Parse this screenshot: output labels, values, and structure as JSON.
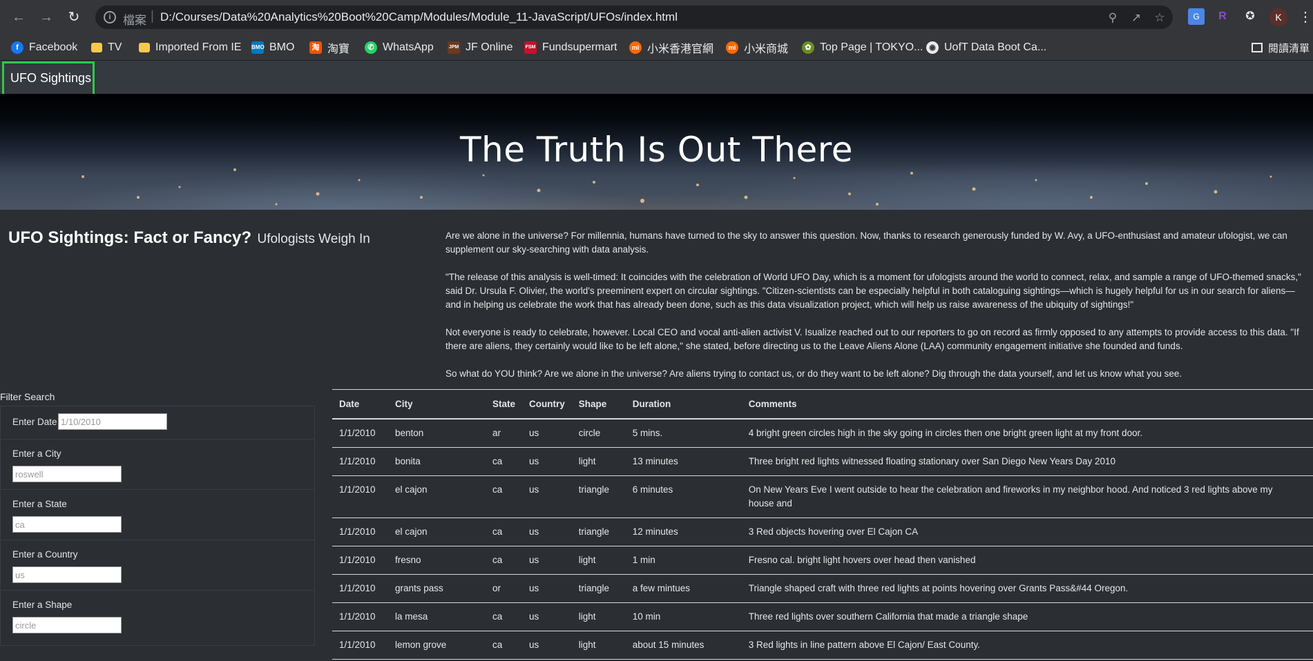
{
  "browser": {
    "url_scheme": "檔案",
    "url": "D:/Courses/Data%20Analytics%20Boot%20Camp/Modules/Module_11-JavaScript/UFOs/index.html",
    "profile_initial": "K",
    "bookmarks": [
      {
        "label": "Facebook",
        "icon": "facebook-icon",
        "color": "#1877f2"
      },
      {
        "label": "TV",
        "icon": "folder-icon",
        "color": "#f6c94a"
      },
      {
        "label": "Imported From IE",
        "icon": "folder-icon",
        "color": "#f6c94a"
      },
      {
        "label": "BMO",
        "icon": "bmo-icon",
        "color": "#0079c1"
      },
      {
        "label": "淘寶",
        "icon": "taobao-icon",
        "color": "#ff5000"
      },
      {
        "label": "WhatsApp",
        "icon": "whatsapp-icon",
        "color": "#25d366"
      },
      {
        "label": "JF Online",
        "icon": "jpm-icon",
        "color": "#6b3a1f"
      },
      {
        "label": "Fundsupermart",
        "icon": "fsm-icon",
        "color": "#c8102e"
      },
      {
        "label": "小米香港官網",
        "icon": "mi-icon",
        "color": "#ff6900"
      },
      {
        "label": "小米商城",
        "icon": "mi-icon",
        "color": "#ff6900"
      },
      {
        "label": "Top Page | TOKYO...",
        "icon": "tokyo-icon",
        "color": "#6b8e23"
      },
      {
        "label": "UofT Data Boot Ca...",
        "icon": "globe-icon",
        "color": "#e8eaed"
      }
    ],
    "reading_list": "閱讀清單"
  },
  "navbar": {
    "brand": "UFO Sightings"
  },
  "hero": {
    "title": "The Truth Is Out There"
  },
  "intro": {
    "title": "UFO Sightings: Fact or Fancy?",
    "subtitle": "Ufologists Weigh In",
    "paragraphs": [
      "Are we alone in the universe? For millennia, humans have turned to the sky to answer this question. Now, thanks to research generously funded by W. Avy, a UFO-enthusiast and amateur ufologist, we can supplement our sky-searching with data analysis.",
      "\"The release of this analysis is well-timed: It coincides with the celebration of World UFO Day, which is a moment for ufologists around the world to connect, relax, and sample a range of UFO-themed snacks,\" said Dr. Ursula F. Olivier, the world's preeminent expert on circular sightings. \"Citizen-scientists can be especially helpful in both cataloguing sightings—which is hugely helpful for us in our search for aliens—and in helping us celebrate the work that has already been done, such as this data visualization project, which will help us raise awareness of the ubiquity of sightings!\"",
      "Not everyone is ready to celebrate, however. Local CEO and vocal anti-alien activist V. Isualize reached out to our reporters to go on record as firmly opposed to any attempts to provide access to this data. \"If there are aliens, they certainly would like to be left alone,\" she stated, before directing us to the Leave Aliens Alone (LAA) community engagement initiative she founded and funds.",
      "So what do YOU think? Are we alone in the universe? Are aliens trying to contact us, or do they want to be left alone? Dig through the data yourself, and let us know what you see."
    ]
  },
  "filters": {
    "heading": "Filter Search",
    "date": {
      "label": "Enter Date",
      "placeholder": "1/10/2010"
    },
    "city": {
      "label": "Enter a City",
      "placeholder": "roswell"
    },
    "state": {
      "label": "Enter a State",
      "placeholder": "ca"
    },
    "country": {
      "label": "Enter a Country",
      "placeholder": "us"
    },
    "shape": {
      "label": "Enter a Shape",
      "placeholder": "circle"
    }
  },
  "table": {
    "headers": [
      "Date",
      "City",
      "State",
      "Country",
      "Shape",
      "Duration",
      "Comments"
    ],
    "rows": [
      [
        "1/1/2010",
        "benton",
        "ar",
        "us",
        "circle",
        "5 mins.",
        "4 bright green circles high in the sky going in circles then one bright green light at my front door."
      ],
      [
        "1/1/2010",
        "bonita",
        "ca",
        "us",
        "light",
        "13 minutes",
        "Three bright red lights witnessed floating stationary over San Diego New Years Day 2010"
      ],
      [
        "1/1/2010",
        "el cajon",
        "ca",
        "us",
        "triangle",
        "6 minutes",
        "On New Years Eve I went outside to hear the celebration and fireworks in my neighbor hood. And noticed 3 red lights above my house and"
      ],
      [
        "1/1/2010",
        "el cajon",
        "ca",
        "us",
        "triangle",
        "12 minutes",
        "3 Red objects hovering over El Cajon CA"
      ],
      [
        "1/1/2010",
        "fresno",
        "ca",
        "us",
        "light",
        "1 min",
        "Fresno cal. bright light hovers over head then vanished"
      ],
      [
        "1/1/2010",
        "grants pass",
        "or",
        "us",
        "triangle",
        "a few mintues",
        "Triangle shaped craft with three red lights at points hovering over Grants Pass&#44 Oregon."
      ],
      [
        "1/1/2010",
        "la mesa",
        "ca",
        "us",
        "light",
        "10 min",
        "Three red lights over southern California that made a triangle shape"
      ],
      [
        "1/1/2010",
        "lemon grove",
        "ca",
        "us",
        "light",
        "about 15 minutes",
        "3 Red lights in line pattern above El Cajon/ East County."
      ]
    ]
  }
}
